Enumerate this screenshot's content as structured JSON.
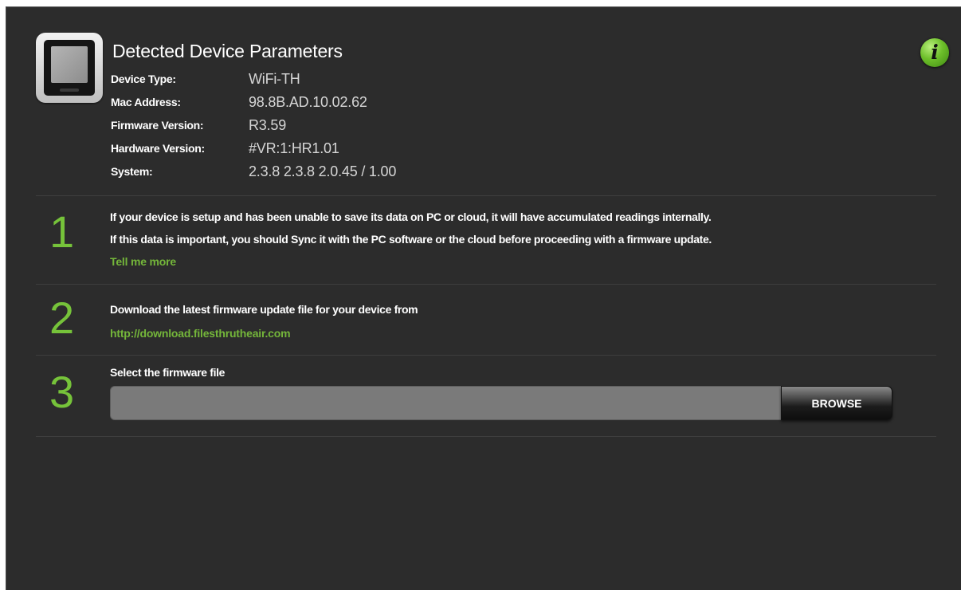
{
  "header": {
    "title": "Detected Device Parameters",
    "info_icon_glyph": "i"
  },
  "icons": {
    "device": "device-icon",
    "info": "info-icon"
  },
  "parameters": [
    {
      "label": "Device Type:",
      "value": "WiFi-TH"
    },
    {
      "label": "Mac Address:",
      "value": "98.8B.AD.10.02.62"
    },
    {
      "label": "Firmware Version:",
      "value": "R3.59"
    },
    {
      "label": "Hardware Version:",
      "value": "#VR:1:HR1.01"
    },
    {
      "label": "System:",
      "value": "2.3.8 2.3.8 2.0.45 / 1.00"
    }
  ],
  "steps": [
    {
      "number": "1",
      "lines": [
        "If your device is setup and has been unable to save its data on PC or cloud, it will have accumulated readings internally.",
        "If this data is important, you should Sync it with the PC software or the cloud before proceeding with a firmware update."
      ],
      "link": "Tell me more"
    },
    {
      "number": "2",
      "lines": [
        "Download the latest firmware update file for your device from"
      ],
      "link": "http://download.filesthrutheair.com"
    },
    {
      "number": "3",
      "lines": [
        "Select the firmware file"
      ],
      "file_input_value": "",
      "button_label": "BROWSE"
    }
  ],
  "colors": {
    "background": "#2c2c2c",
    "accent": "#76c33a",
    "text": "#ffffff",
    "value_text": "#d6d6d6"
  }
}
